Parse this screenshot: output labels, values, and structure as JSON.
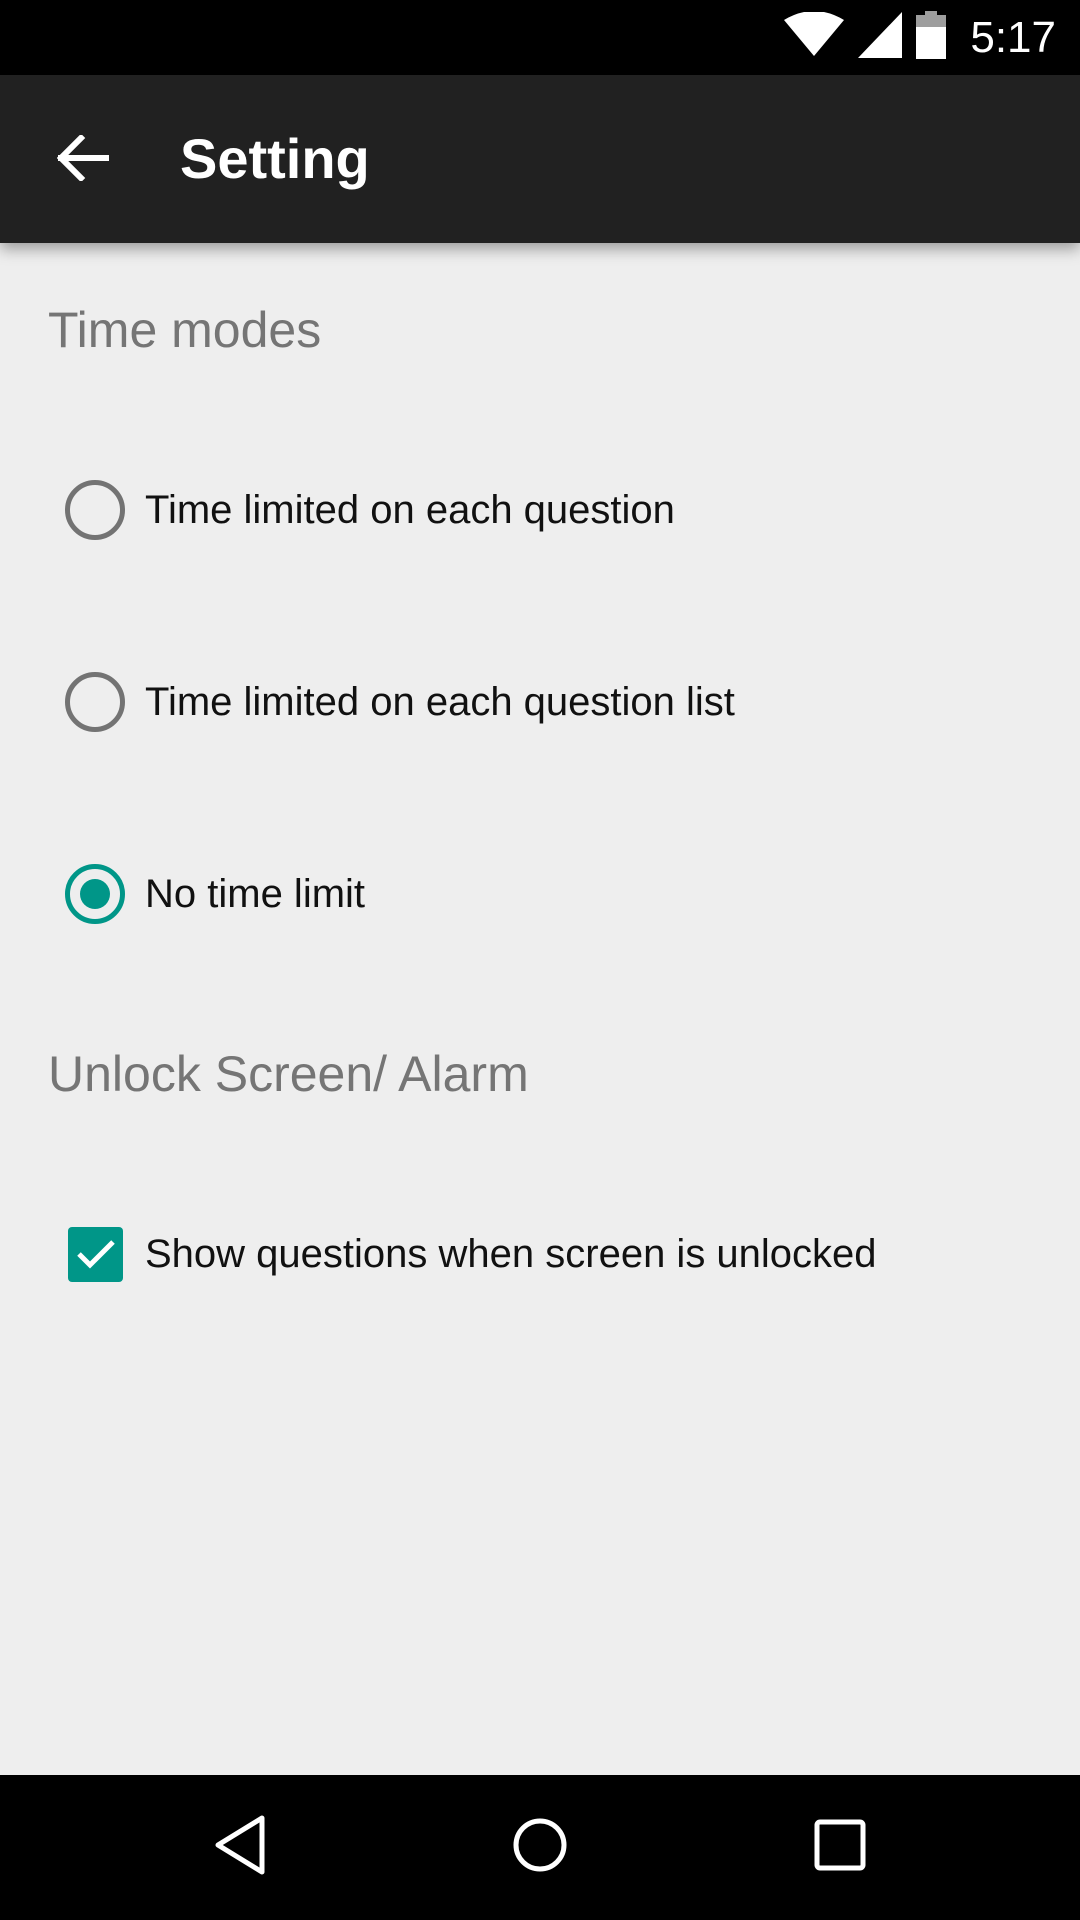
{
  "status_bar": {
    "time": "5:17",
    "icons": [
      "wifi-icon",
      "cellular-signal-icon",
      "battery-icon"
    ]
  },
  "app_bar": {
    "title": "Setting",
    "back_icon": "arrow-back-icon"
  },
  "sections": {
    "time_modes": {
      "header": "Time modes",
      "options": [
        {
          "label": "Time limited on each question",
          "selected": false
        },
        {
          "label": "Time limited on each question list",
          "selected": false
        },
        {
          "label": "No time limit",
          "selected": true
        }
      ]
    },
    "unlock": {
      "header": "Unlock Screen/ Alarm",
      "options": [
        {
          "label": "Show questions when screen is unlocked",
          "checked": true
        }
      ]
    }
  },
  "nav_bar": {
    "icons": [
      "back-triangle-icon",
      "home-circle-icon",
      "recents-square-icon"
    ]
  },
  "colors": {
    "accent": "#009688",
    "app_bar": "#212121",
    "background": "#eeeeee",
    "section_header": "#757575"
  }
}
